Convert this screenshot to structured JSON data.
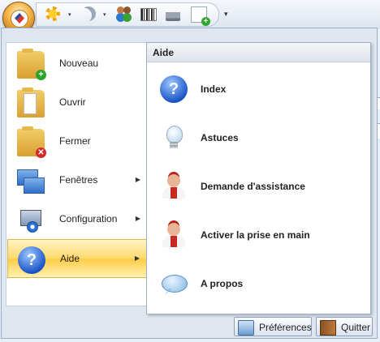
{
  "toolbar": {
    "orb": "app-menu-orb",
    "quick_access": [
      "sun-icon",
      "moon-icon",
      "users-icon",
      "barcode-icon",
      "printer-icon",
      "new-document-icon"
    ],
    "dropdown_glyph": "▾",
    "more_glyph": "▾"
  },
  "left_menu": {
    "items": [
      {
        "label": "Nouveau",
        "icon": "folder-add-icon",
        "has_submenu": false
      },
      {
        "label": "Ouvrir",
        "icon": "folder-open-icon",
        "has_submenu": false
      },
      {
        "label": "Fermer",
        "icon": "folder-close-icon",
        "has_submenu": false
      },
      {
        "label": "Fenêtres",
        "icon": "windows-icon",
        "has_submenu": true
      },
      {
        "label": "Configuration",
        "icon": "configuration-icon",
        "has_submenu": true
      },
      {
        "label": "Aide",
        "icon": "help-icon",
        "has_submenu": true,
        "active": true
      }
    ],
    "arrow_glyph": "▶"
  },
  "submenu": {
    "title": "Aide",
    "items": [
      {
        "label": "Index",
        "icon": "help-icon"
      },
      {
        "label": "Astuces",
        "icon": "lightbulb-icon"
      },
      {
        "label": "Demande d'assistance",
        "icon": "support-person-icon"
      },
      {
        "label": "Activer la prise en main",
        "icon": "support-person-icon"
      },
      {
        "label": "A propos",
        "icon": "speech-bubble-icon"
      }
    ]
  },
  "footer": {
    "preferences_label": "Préférences",
    "quit_label": "Quitter"
  },
  "colors": {
    "active_highlight": "#ffd96b",
    "menu_background": "#dfe6ef",
    "border": "#9daec4"
  }
}
